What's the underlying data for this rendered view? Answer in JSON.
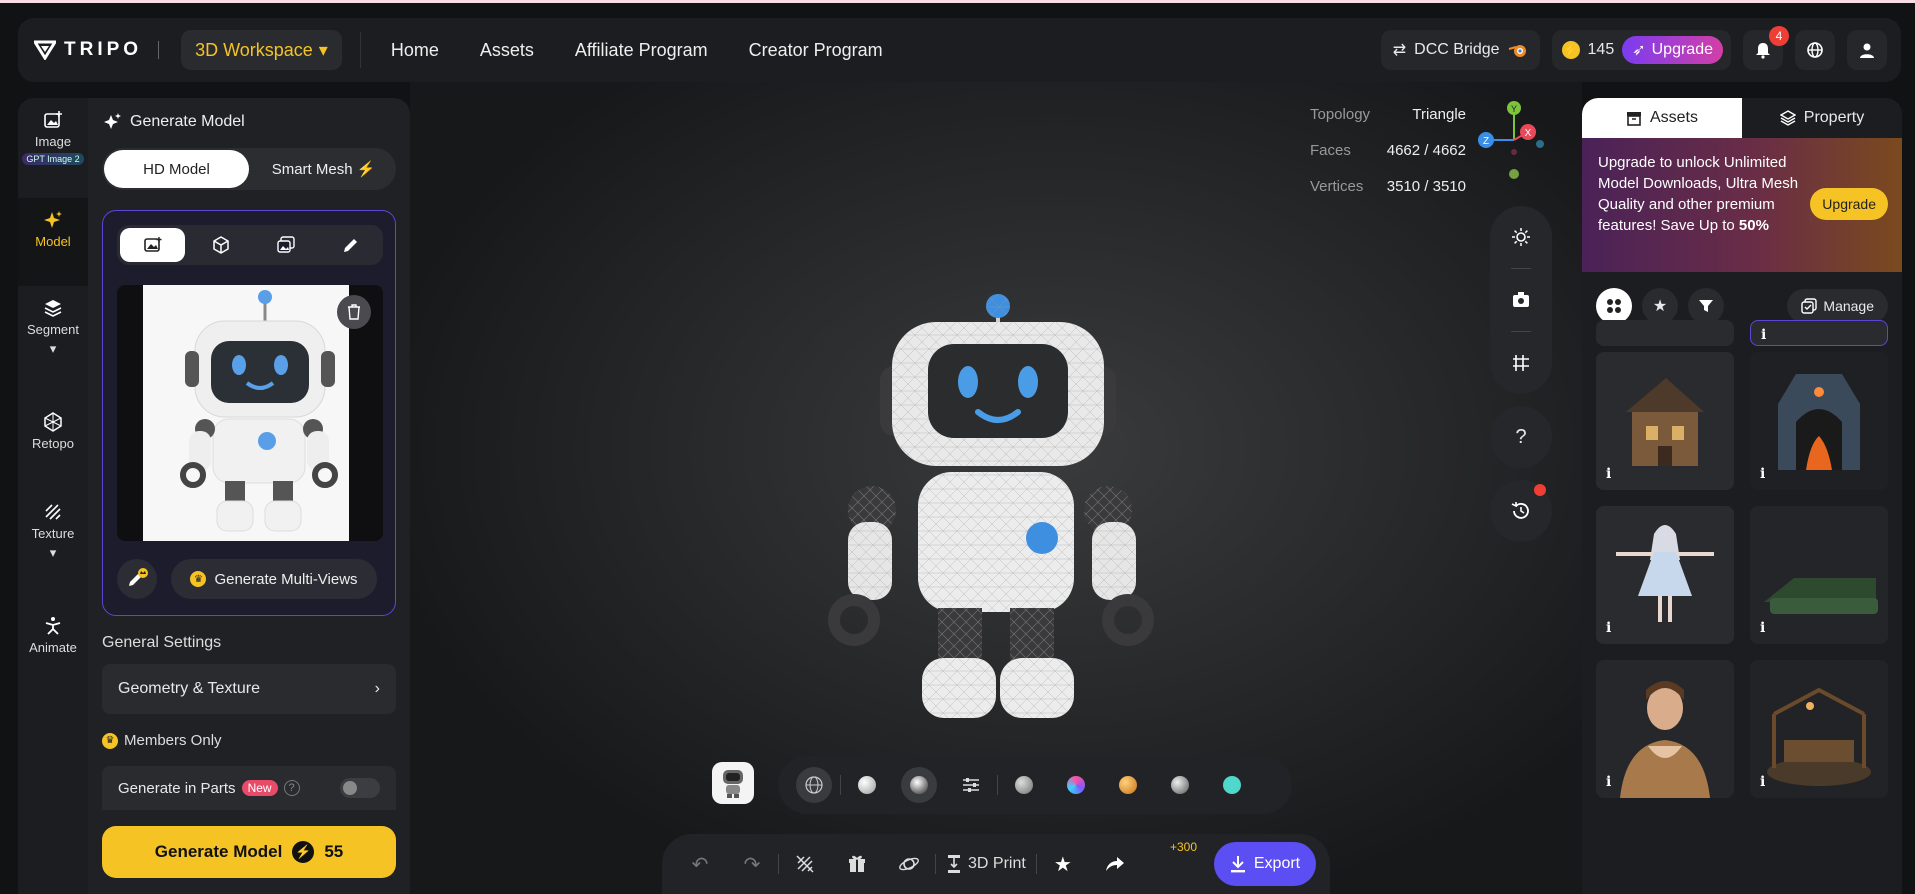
{
  "header": {
    "logo_text": "TRIPO",
    "workspace_label": "3D Workspace",
    "nav": [
      "Home",
      "Assets",
      "Affiliate Program",
      "Creator Program"
    ],
    "dcc_label": "DCC Bridge",
    "credits": "145",
    "upgrade_label": "Upgrade",
    "notifications": "4"
  },
  "rail": {
    "items": [
      {
        "label": "Image",
        "badge": "GPT Image 2",
        "icon": "image-plus-icon"
      },
      {
        "label": "Model",
        "icon": "sparkle-icon"
      },
      {
        "label": "Segment",
        "icon": "layers-icon"
      },
      {
        "label": "Retopo",
        "icon": "polyhedron-icon"
      },
      {
        "label": "Texture",
        "icon": "hatch-icon"
      },
      {
        "label": "Animate",
        "icon": "figure-icon"
      }
    ]
  },
  "left_panel": {
    "title": "Generate Model",
    "segment": [
      "HD Model",
      "Smart Mesh"
    ],
    "generate_multi_views": "Generate Multi-Views",
    "general_settings": "General Settings",
    "geometry_texture": "Geometry & Texture",
    "members_only": "Members Only",
    "generate_in_parts": "Generate in Parts",
    "new_badge": "New",
    "generate_button": "Generate Model",
    "generate_cost": "55"
  },
  "viewport": {
    "stats": [
      {
        "key": "Topology",
        "value": "Triangle"
      },
      {
        "key": "Faces",
        "value": "4662 / 4662"
      },
      {
        "key": "Vertices",
        "value": "3510 / 3510"
      }
    ],
    "axes": {
      "x": "X",
      "y": "Y",
      "z": "Z"
    },
    "help": "?",
    "toolbar": {
      "print_label": "3D Print",
      "plus_badge": "+300",
      "export_label": "Export"
    },
    "material_colors": [
      "#b9b9b9",
      "#7c5cff",
      "#e9962b",
      "#9a9a9a",
      "#4fd7c9"
    ]
  },
  "right_panel": {
    "tabs": [
      "Assets",
      "Property"
    ],
    "promo_text_1": "Upgrade to unlock Unlimited Model Downloads, Ultra Mesh Quality and other premium features! Save Up to ",
    "promo_highlight": "50%",
    "promo_button": "Upgrade",
    "manage_label": "Manage",
    "tile_info": "i"
  },
  "colors": {
    "accent_yellow": "#f6c324",
    "export_purple": "#5b4ef2",
    "panel": "#202124"
  }
}
